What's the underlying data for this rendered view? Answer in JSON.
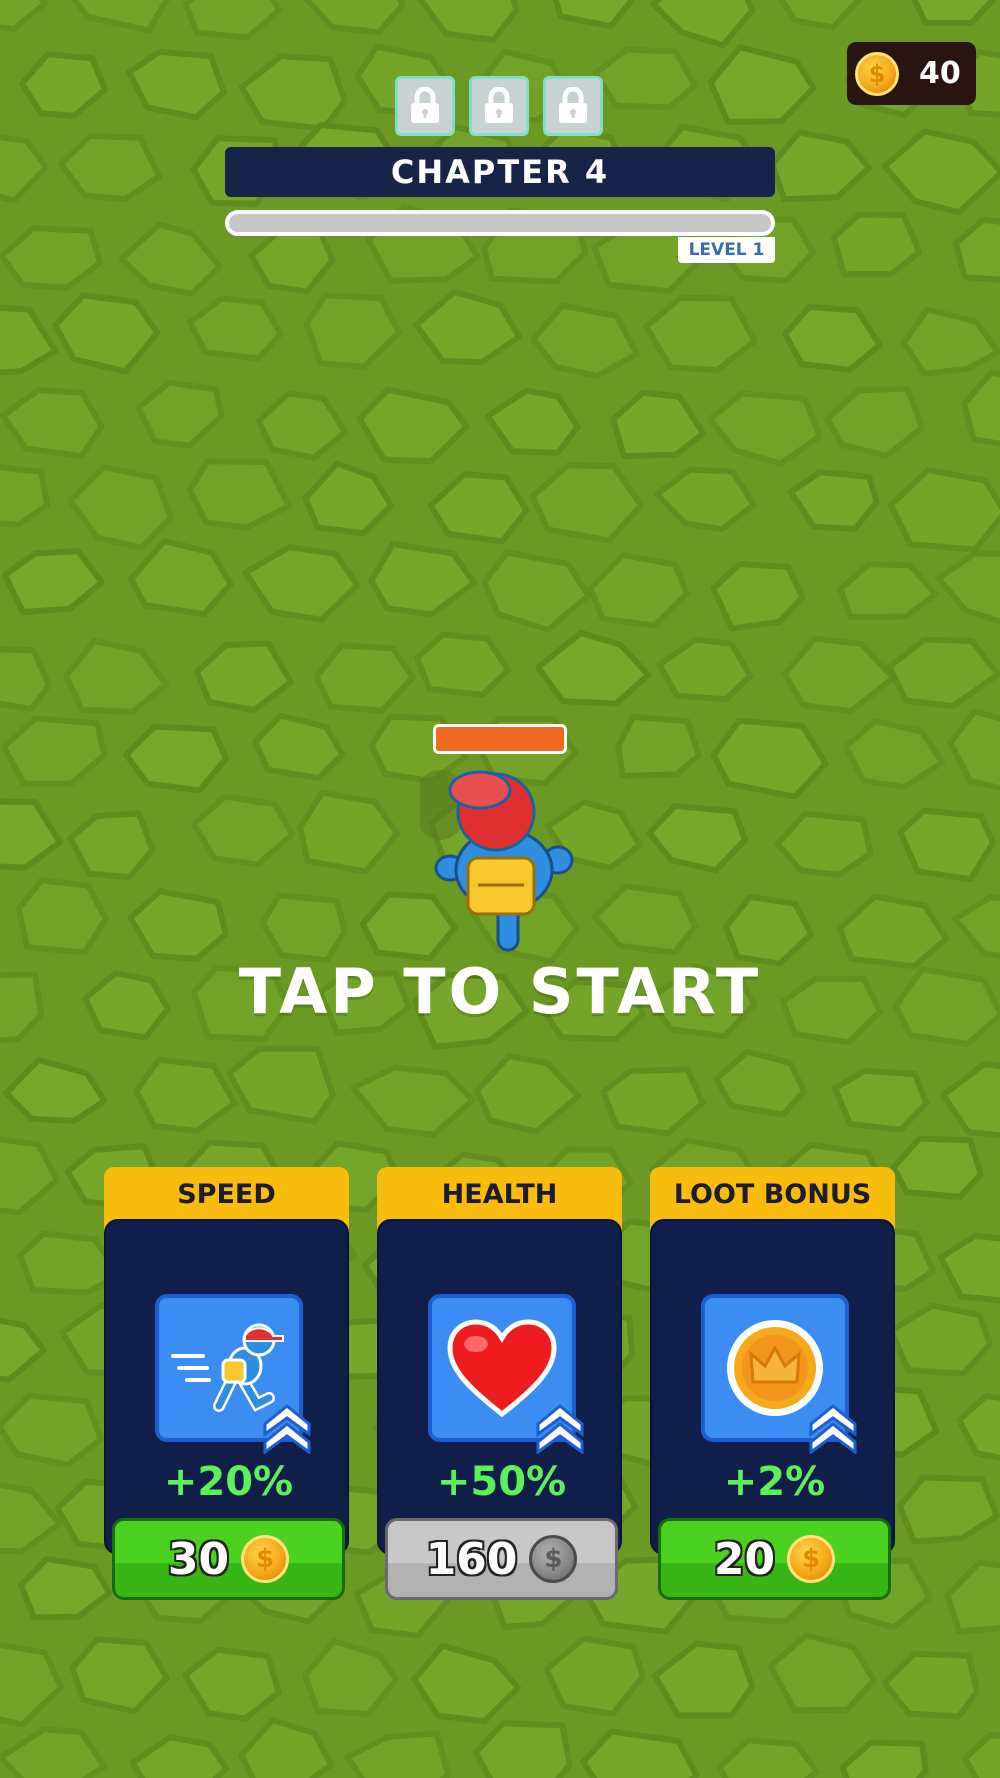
{
  "hud": {
    "coins": "40",
    "coin_icon": "gold-coin-icon",
    "locks": [
      "lock-icon",
      "lock-icon",
      "lock-icon"
    ],
    "chapter_title": "CHAPTER 4",
    "level_label": "LEVEL 1",
    "chapter_progress": 0
  },
  "player": {
    "health_fraction": 1.0,
    "health_color": "#ef6a25"
  },
  "prompt": "TAP TO START",
  "upgrades": [
    {
      "title": "SPEED",
      "icon": "running-character-icon",
      "bonus": "+20%",
      "price": "30",
      "affordable": true,
      "price_icon": "gold-coin-icon"
    },
    {
      "title": "HEALTH",
      "icon": "heart-icon",
      "bonus": "+50%",
      "price": "160",
      "affordable": false,
      "price_icon": "gray-coin-icon"
    },
    {
      "title": "LOOT BONUS",
      "icon": "crown-coin-icon",
      "bonus": "+2%",
      "price": "20",
      "affordable": true,
      "price_icon": "gold-coin-icon"
    }
  ],
  "colors": {
    "ground": "#6a9a24",
    "panel_navy": "#162449",
    "card_header": "#f8bd0c",
    "bonus_text": "#5ef05a",
    "buy_green": "#4bd21e",
    "buy_gray": "#c8c8c8"
  }
}
